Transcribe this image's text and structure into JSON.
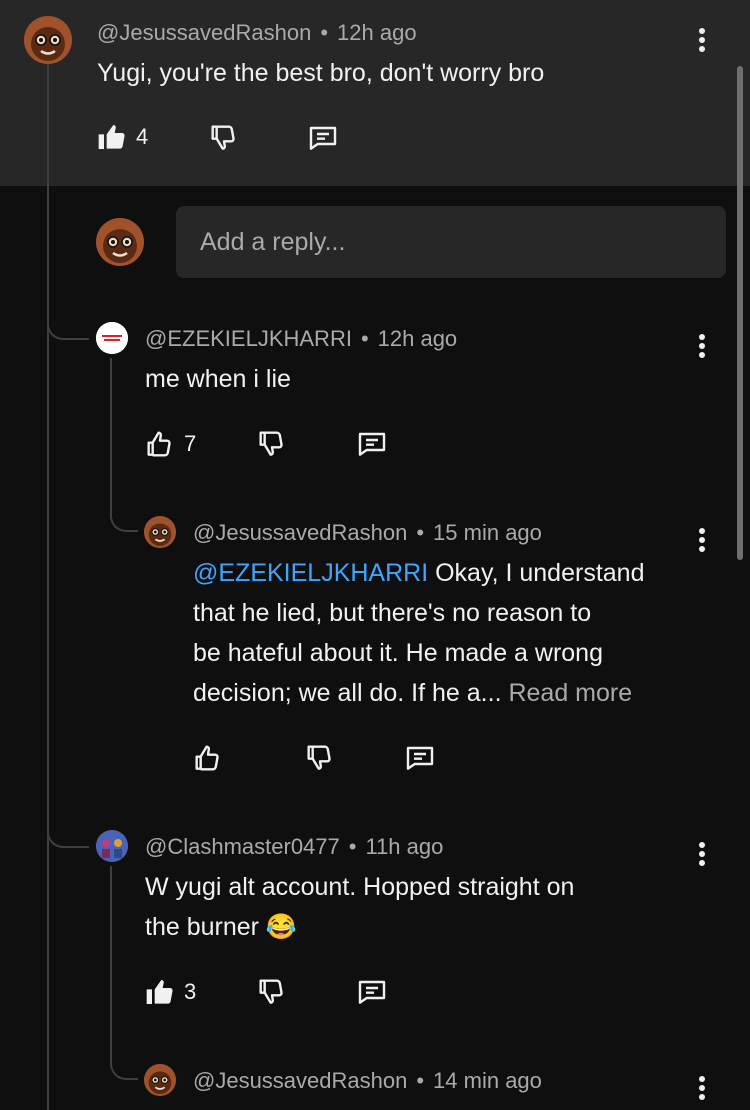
{
  "comment": {
    "author": "@JesussavedRashon",
    "time": "12h ago",
    "text": "Yugi, you're the best bro, don't worry bro",
    "likes": "4"
  },
  "reply_box": {
    "placeholder": "Add a reply..."
  },
  "replies": [
    {
      "author": "@EZEKIELJKHARRI",
      "time": "12h ago",
      "text": "me when i lie",
      "likes": "7"
    },
    {
      "author": "@JesussavedRashon",
      "time": "15 min ago",
      "mention": "@EZEKIELJKHARRI",
      "line1_rest": " Okay, I understand",
      "line2": "that he lied, but there's no reason to",
      "line3": "be hateful about it. He made a wrong",
      "line4": "decision; we all do. If he a...",
      "read_more": "Read more"
    },
    {
      "author": "@Clashmaster0477",
      "time": "11h ago",
      "line1": "W yugi alt account. Hopped straight on",
      "line2": "the burner 😂",
      "likes": "3"
    },
    {
      "author": "@JesussavedRashon",
      "time": "14 min ago"
    }
  ],
  "separator": "•",
  "icons": {
    "like_filled": "thumbs-up-filled-icon",
    "like_outline": "thumbs-up-outline-icon",
    "dislike": "thumbs-down-outline-icon",
    "reply": "comment-reply-icon",
    "menu": "more-vertical-icon"
  },
  "colors": {
    "background": "#0f0f0f",
    "highlight": "#272727",
    "mention": "#3ea6ff",
    "secondary_text": "#aaaaaa"
  }
}
